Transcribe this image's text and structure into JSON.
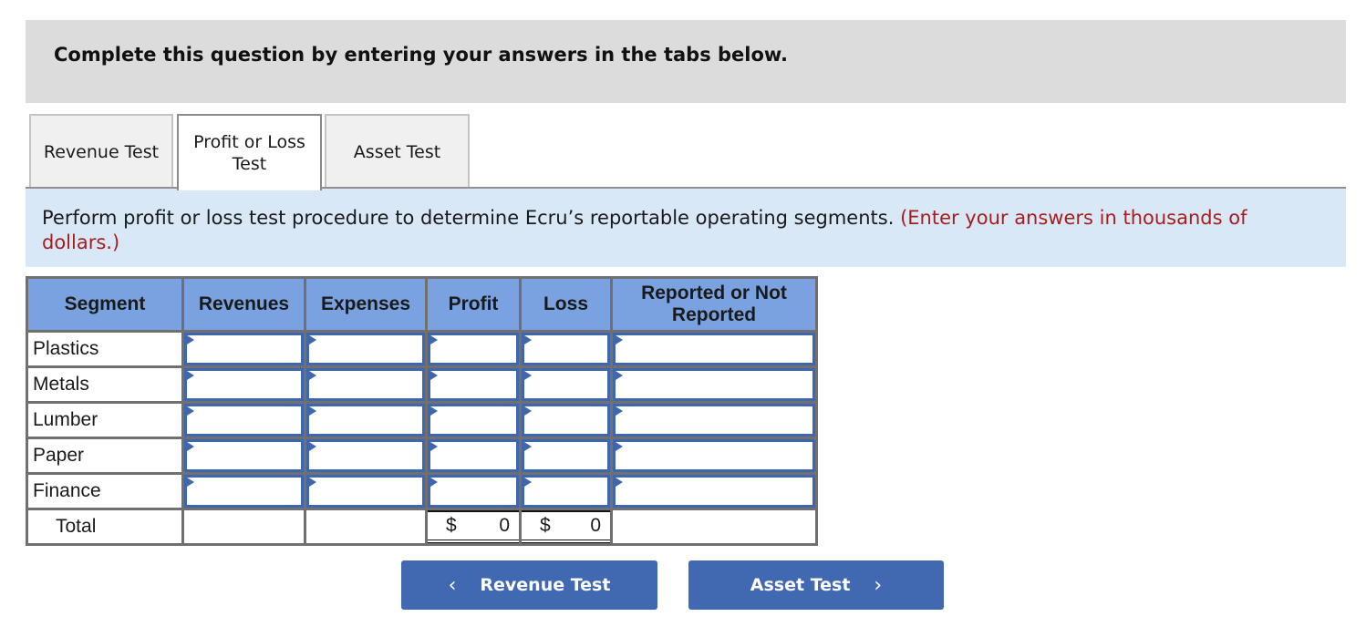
{
  "instruction": "Complete this question by entering your answers in the tabs below.",
  "tabs": [
    {
      "label": "Revenue Test",
      "active": false
    },
    {
      "label": "Profit or Loss Test",
      "active": true
    },
    {
      "label": "Asset Test",
      "active": false
    }
  ],
  "prompt": {
    "text": "Perform profit or loss test procedure to determine Ecru’s reportable operating segments.",
    "note": "(Enter your answers in thousands of dollars.)"
  },
  "table": {
    "headers": [
      "Segment",
      "Revenues",
      "Expenses",
      "Profit",
      "Loss",
      "Reported or Not Reported"
    ],
    "rows": [
      {
        "segment": "Plastics",
        "revenues": "",
        "expenses": "",
        "profit": "",
        "loss": "",
        "reported": ""
      },
      {
        "segment": "Metals",
        "revenues": "",
        "expenses": "",
        "profit": "",
        "loss": "",
        "reported": ""
      },
      {
        "segment": "Lumber",
        "revenues": "",
        "expenses": "",
        "profit": "",
        "loss": "",
        "reported": ""
      },
      {
        "segment": "Paper",
        "revenues": "",
        "expenses": "",
        "profit": "",
        "loss": "",
        "reported": ""
      },
      {
        "segment": "Finance",
        "revenues": "",
        "expenses": "",
        "profit": "",
        "loss": "",
        "reported": ""
      }
    ],
    "total": {
      "label": "Total",
      "profit_currency": "$",
      "profit_value": "0",
      "loss_currency": "$",
      "loss_value": "0"
    }
  },
  "nav": {
    "prev_label": "Revenue Test",
    "next_label": "Asset Test",
    "prev_icon": "‹",
    "next_icon": "›"
  },
  "colors": {
    "header_bg": "#7aa2e0",
    "button_bg": "#4169b2",
    "prompt_bg": "#d9e8f7",
    "note_red": "#a51e1e"
  }
}
